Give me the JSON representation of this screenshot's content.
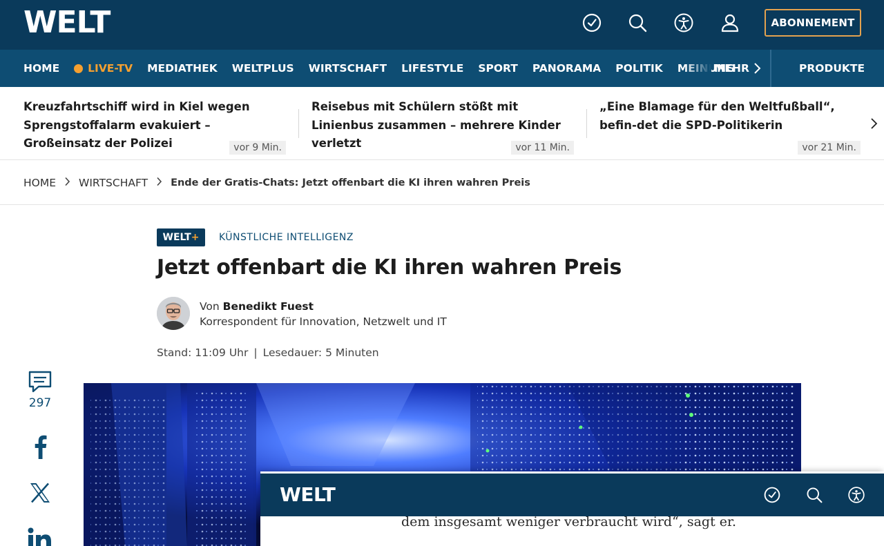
{
  "header": {
    "logo": "WELT",
    "icons": [
      "clock-check-icon",
      "search-icon",
      "accessibility-icon",
      "user-icon"
    ],
    "subscribe_label": "ABONNEMENT"
  },
  "nav": {
    "items": [
      "HOME",
      "LIVE-TV",
      "MEDIATHEK",
      "WELTPLUS",
      "WIRTSCHAFT",
      "LIFESTYLE",
      "SPORT",
      "PANORAMA",
      "POLITIK",
      "MEINUNG"
    ],
    "more_label": "MEHR",
    "products_label": "PRODUKTE"
  },
  "ticker": [
    {
      "title": "Kreuzfahrtschiff wird in Kiel wegen Sprengstoffalarm evakuiert – Großeinsatz der Polizei",
      "time": "vor 9 Min."
    },
    {
      "title": "Reisebus mit Schülern stößt mit Linienbus zusammen – mehrere Kinder verletzt",
      "time": "vor 11 Min."
    },
    {
      "title": "„Eine Blamage für den Weltfußball“, befin-det die SPD-Politikerin",
      "time": "vor 21 Min."
    }
  ],
  "breadcrumb": {
    "items": [
      "HOME",
      "WIRTSCHAFT"
    ],
    "current": "Ende der Gratis-Chats: Jetzt offenbart die KI ihren wahren Preis"
  },
  "article": {
    "badge_text": "WELT",
    "badge_plus": "+",
    "topic": "KÜNSTLICHE INTELLIGENZ",
    "headline": "Jetzt offenbart die KI ihren wahren Preis",
    "author_prefix": "Von",
    "author_name": "Benedikt Fuest",
    "author_role": "Korrespondent für Innovation, Netzwelt und IT",
    "stand": "Stand: 11:09 Uhr",
    "read_time": "Lesedauer: 5 Minuten"
  },
  "social": {
    "comment_count": "297",
    "icons": [
      "comment-icon",
      "facebook-icon",
      "x-icon",
      "linkedin-icon"
    ]
  },
  "sticky": {
    "logo": "WELT",
    "icons": [
      "clock-check-icon",
      "search-icon",
      "accessibility-icon"
    ],
    "text": "dem insgesamt weniger verbraucht wird“, sagt er."
  },
  "colors": {
    "header_bg": "#0a3a5b",
    "nav_bg": "#0e4d73",
    "accent": "#f5a030"
  }
}
